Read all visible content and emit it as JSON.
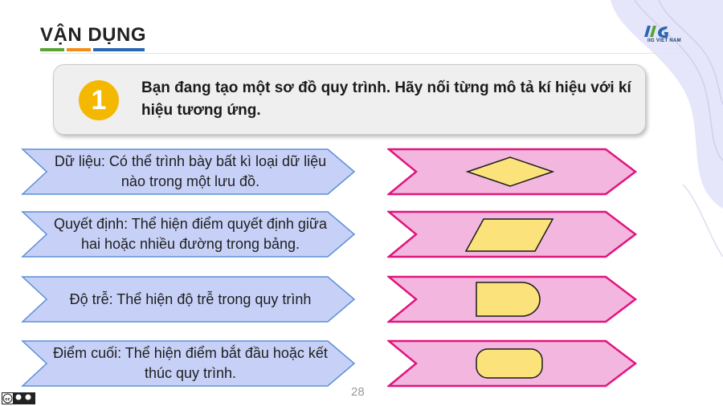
{
  "header": {
    "title": "VẬN DỤNG",
    "bar_colors": [
      "#5aa332",
      "#f28c1a",
      "#2a67b1"
    ]
  },
  "logo": {
    "text": "IIG VIET NAM"
  },
  "question": {
    "number": "1",
    "text": "Bạn đang tạo một sơ đồ quy trình. Hãy nối từng mô tả kí hiệu với kí hiệu tương ứng."
  },
  "descriptions": [
    {
      "text": "Dữ liệu: Có thể trình bày bất kì loại dữ liệu nào trong một lưu đồ."
    },
    {
      "text": "Quyết định: Thể hiện điểm quyết định giữa hai hoặc nhiều đường trong bảng."
    },
    {
      "text": "Độ trễ: Thể hiện độ trễ trong quy trình"
    },
    {
      "text": "Điểm cuối: Thể hiện điểm bắt đầu hoặc kết thúc quy trình."
    }
  ],
  "symbols": [
    {
      "shape": "diamond"
    },
    {
      "shape": "parallelogram"
    },
    {
      "shape": "delay"
    },
    {
      "shape": "terminator"
    }
  ],
  "colors": {
    "left_fill": "#c7d1f7",
    "left_stroke": "#5b8fd6",
    "right_fill": "#f2b6df",
    "right_stroke": "#e0157d",
    "symbol_fill": "#fbe27a",
    "symbol_stroke": "#1b1b1b"
  },
  "footer": {
    "page_number": "28",
    "license_badge": "cc by sa"
  }
}
